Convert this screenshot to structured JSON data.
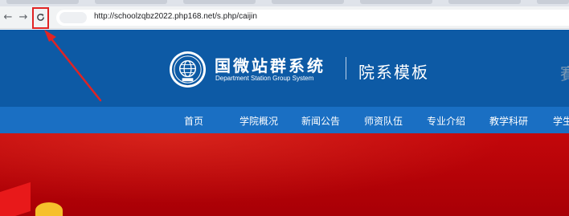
{
  "browser": {
    "url": "http://schoolzqbz2022.php168.net/s.php/caijin",
    "back_icon": "arrow-left-icon",
    "forward_icon": "arrow-right-icon",
    "reload_icon": "reload-icon"
  },
  "header": {
    "brand_cn": "国微站群系统",
    "brand_en": "Department Station Group System",
    "subtitle": "院系模板",
    "edge_glyph": "賽"
  },
  "nav": {
    "items": [
      "首页",
      "学院概况",
      "新闻公告",
      "师资队伍",
      "专业介绍",
      "教学科研",
      "学生"
    ]
  },
  "colors": {
    "header_blue": "#0d5aa5",
    "nav_blue": "#1a6fc3",
    "banner_red": "#b40207",
    "annotation_red": "#e02424"
  }
}
